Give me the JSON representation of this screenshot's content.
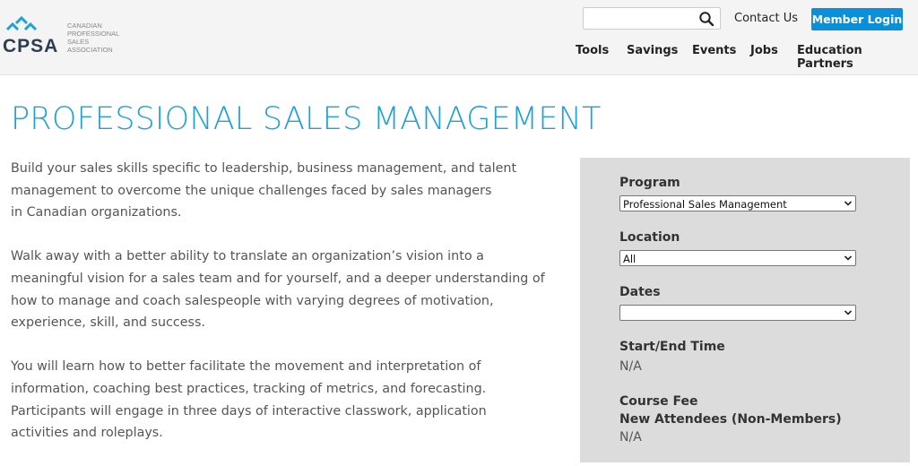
{
  "header": {
    "logo": {
      "abbr": "CPSA",
      "name_lines": [
        "CANADIAN",
        "PROFESSIONAL",
        "SALES",
        "ASSOCIATION"
      ]
    },
    "search": {
      "value": "",
      "placeholder": ""
    },
    "contact_label": "Contact Us",
    "member_login_label": "Member Login",
    "nav": [
      "Tools",
      "Savings",
      "Events",
      "Jobs",
      "Education Partners"
    ]
  },
  "main": {
    "title": "PROFESSIONAL SALES MANAGEMENT",
    "paragraphs": [
      [
        "Build your sales skills specific to leadership, business management, and talent",
        "management to overcome the unique challenges faced by sales managers",
        "in Canadian organizations."
      ],
      [
        "Walk away with a better ability to translate an organization’s vision into a",
        "meaningful vision for a sales team and for yourself, and a deeper understanding of",
        "how to manage and coach salespeople with varying degrees of motivation,",
        "experience, skill, and success."
      ],
      [
        "You will learn how to better facilitate the movement and interpretation of",
        "information, coaching best practices, tracking of metrics, and forecasting.",
        "Participants will engage in three days of interactive classwork, application",
        "activities and roleplays."
      ]
    ]
  },
  "panel": {
    "program": {
      "label": "Program",
      "selected": "Professional Sales Management"
    },
    "location": {
      "label": "Location",
      "selected": "All"
    },
    "dates": {
      "label": "Dates",
      "selected": ""
    },
    "start_end": {
      "label": "Start/End Time",
      "value": "N/A"
    },
    "fee": {
      "label": "Course Fee",
      "sublabel": "New Attendees (Non-Members)",
      "value": "N/A"
    }
  },
  "colors": {
    "accent": "#1ea0dc",
    "button": "#0a8fd8",
    "panel_bg": "#dcdcdc",
    "header_bg": "#f4f4f4"
  }
}
